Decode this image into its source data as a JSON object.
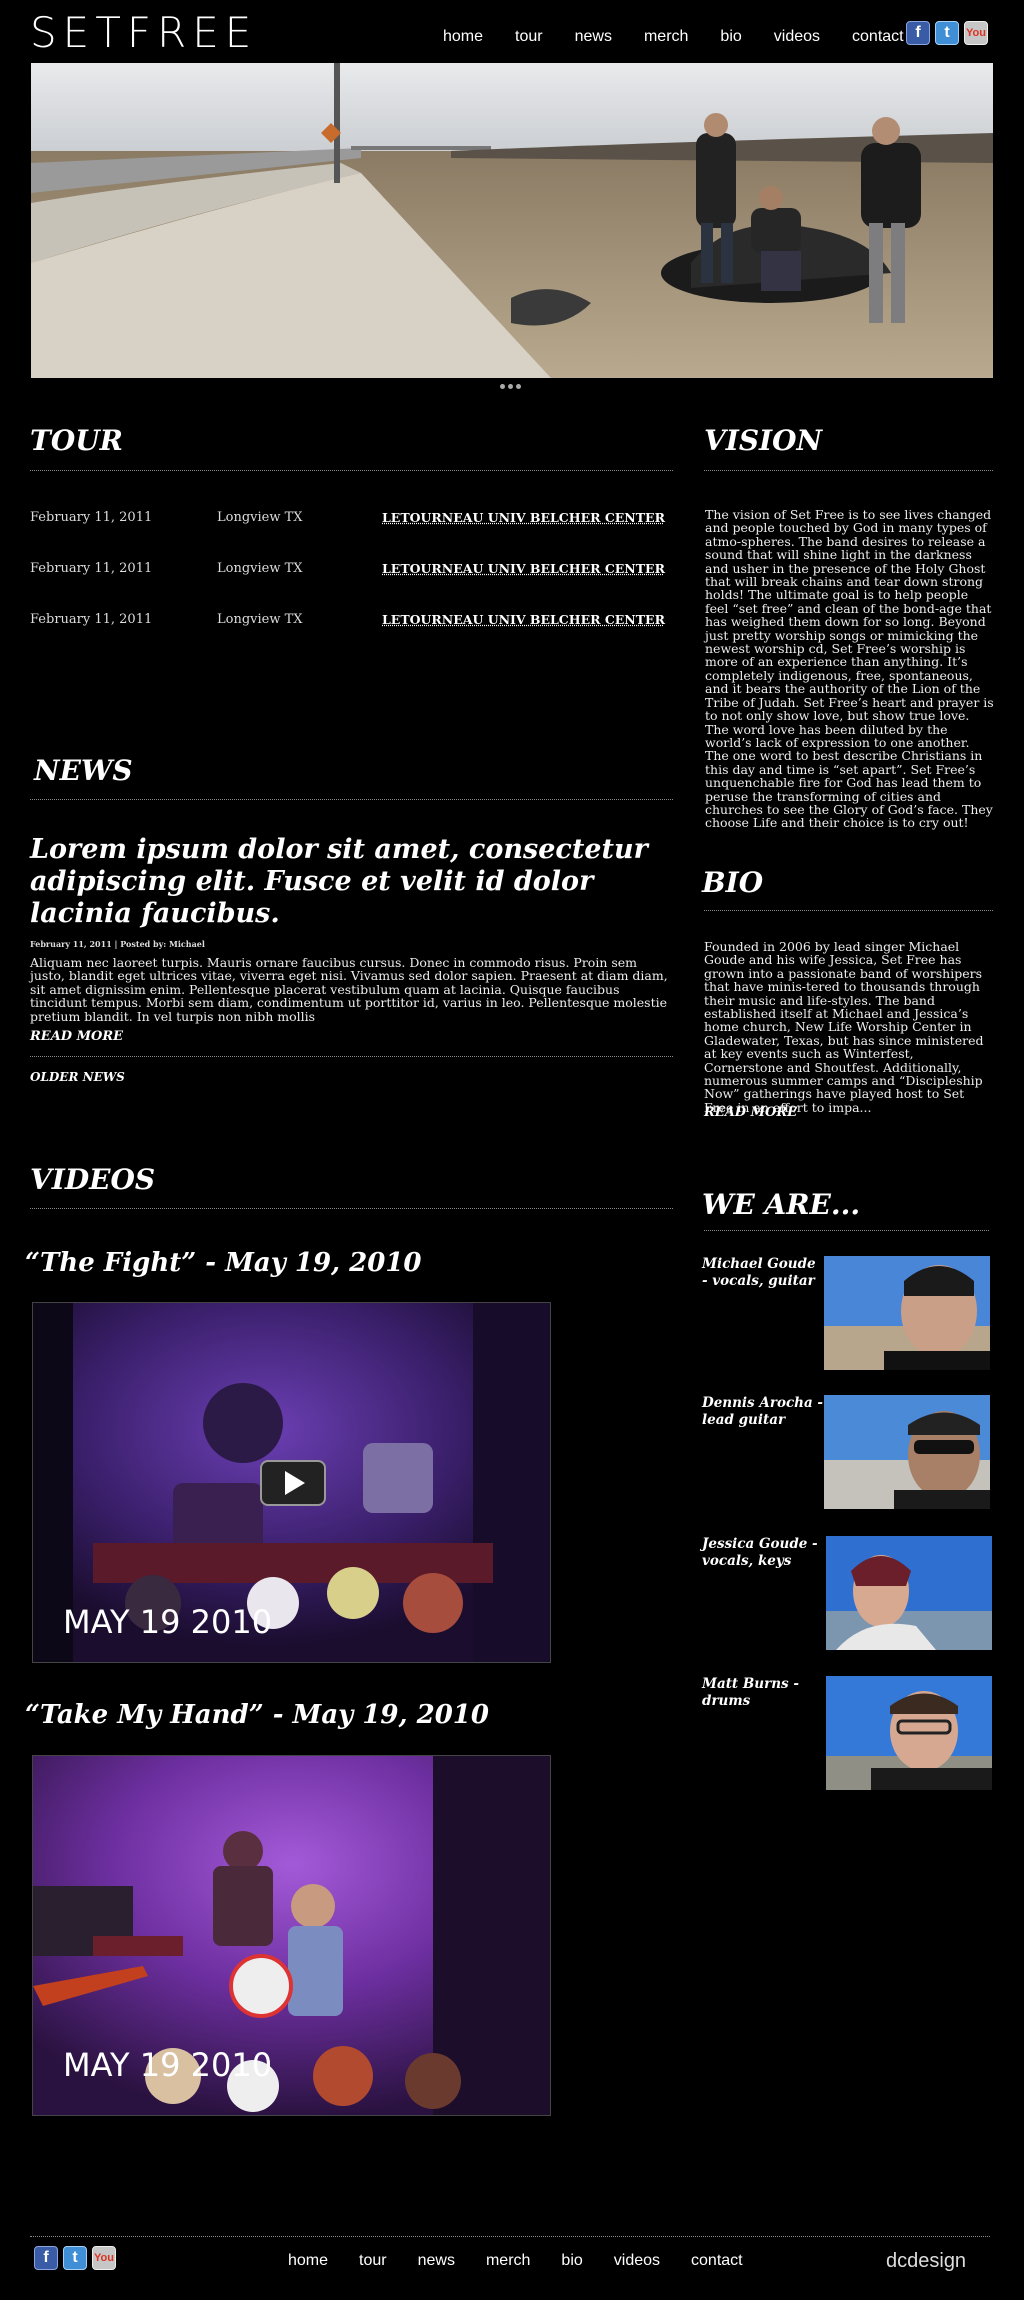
{
  "header": {
    "logo": "SETFREE",
    "nav": [
      "home",
      "tour",
      "news",
      "merch",
      "bio",
      "videos",
      "contact"
    ],
    "social": {
      "facebook": "f",
      "twitter": "t",
      "youtube": "You"
    }
  },
  "tour": {
    "title": "TOUR",
    "rows": [
      {
        "date": "February 11, 2011",
        "city": "Longview TX",
        "venue": "LETOURNEAU UNIV BELCHER CENTER"
      },
      {
        "date": "February 11, 2011",
        "city": "Longview TX",
        "venue": "LETOURNEAU UNIV BELCHER CENTER"
      },
      {
        "date": "February 11, 2011",
        "city": "Longview TX",
        "venue": "LETOURNEAU UNIV BELCHER CENTER"
      }
    ]
  },
  "vision": {
    "title": "VISION",
    "text": "The vision of Set Free is to see lives changed and people touched by God in many types of atmo-spheres. The band desires to release a sound that will shine light in the darkness and usher in the presence of the Holy Ghost that will break chains and tear down strong holds! The ultimate goal is to help people feel “set free” and clean of the bond-age that has weighed them down for so long. Beyond just pretty worship songs or mimicking the newest worship cd, Set Free’s worship is more of an experience than anything. It’s completely indigenous, free, spontaneous, and it bears the authority of the Lion of the Tribe of Judah. Set Free’s heart and prayer is to not only show love, but show true love. The word love has been diluted by the world’s lack of expression to one another. The one word to best describe Christians in this day and time is “set apart”. Set Free’s unquenchable fire for God has lead them to peruse the transforming of cities and churches to see the Glory of God’s face. They choose Life and their choice is to cry out!"
  },
  "news": {
    "title": "NEWS",
    "headline": "Lorem ipsum dolor sit amet, consectetur adipiscing elit. Fusce et velit id dolor lacinia faucibus.",
    "meta": "February 11, 2011  |  Posted by: Michael",
    "body": "Aliquam nec laoreet turpis. Mauris ornare faucibus cursus. Donec in commodo risus. Proin sem justo, blandit eget ultrices vitae, viverra eget nisi. Vivamus sed dolor sapien. Praesent at diam diam, sit amet dignissim enim. Pellentesque placerat vestibulum quam at lacinia. Quisque faucibus tincidunt tempus. Morbi sem diam, condimentum ut porttitor id, varius in leo. Pellentesque molestie pretium blandit. In vel turpis non nibh mollis",
    "read_more": "READ MORE",
    "older": "OLDER NEWS"
  },
  "bio": {
    "title": "BIO",
    "text": "Founded in 2006 by lead singer Michael Goude and his wife Jessica, Set Free has grown into a passionate band of worshipers that have minis-tered to thousands through their music and life-styles. The band established itself at Michael and Jessica’s home church, New Life Worship Center in Gladewater, Texas, but has since ministered at key events such as Winterfest, Cornerstone and Shoutfest. Additionally, numerous summer camps and “Discipleship Now” gatherings have played host to Set Free in an effort to impa...",
    "read_more": "READ MORE"
  },
  "videos": {
    "title": "VIDEOS",
    "items": [
      {
        "title": "“The Fight” - May 19, 2010",
        "stamp": "MAY 19 2010"
      },
      {
        "title": "“Take My Hand” - May 19, 2010",
        "stamp": "MAY 19 2010"
      }
    ]
  },
  "we_are": {
    "title": "WE ARE...",
    "members": [
      {
        "name": "Michael Goude - vocals, guitar"
      },
      {
        "name": "Dennis Arocha - lead guitar"
      },
      {
        "name": "Jessica Goude - vocals, keys"
      },
      {
        "name": "Matt Burns - drums"
      }
    ]
  },
  "footer": {
    "nav": [
      "home",
      "tour",
      "news",
      "merch",
      "bio",
      "videos",
      "contact"
    ],
    "credit": "dcdesign"
  }
}
